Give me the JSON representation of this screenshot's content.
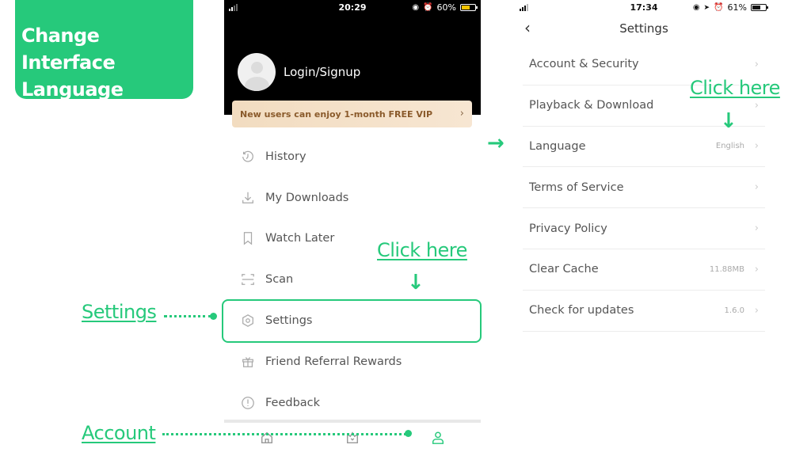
{
  "title_card": {
    "line1": "Change Interface",
    "line2": "Language"
  },
  "annotations": {
    "settings_label": "Settings",
    "account_label": "Account",
    "click_here_1": "Click here",
    "click_here_2": "Click here",
    "arrow_down": "↓",
    "arrow_right": "→"
  },
  "colors": {
    "accent": "#26c97b",
    "vip_bg": "#f2dcc0",
    "vip_text": "#8a5a2b"
  },
  "phone1": {
    "status": {
      "time": "20:29",
      "battery": "60%",
      "battery_fill": 0.6,
      "battery_color": "#f5c400"
    },
    "login_label": "Login/Signup",
    "vip_banner": "New users can enjoy 1-month FREE VIP",
    "chevron": "›",
    "menu": [
      {
        "label": "History",
        "icon": "history-icon"
      },
      {
        "label": "My Downloads",
        "icon": "download-icon"
      },
      {
        "label": "Watch Later",
        "icon": "bookmark-icon"
      },
      {
        "label": "Scan",
        "icon": "scan-icon"
      },
      {
        "label": "Settings",
        "icon": "settings-hexagon-icon"
      },
      {
        "label": "Friend Referral Rewards",
        "icon": "gift-icon"
      },
      {
        "label": "Feedback",
        "icon": "feedback-icon"
      }
    ],
    "tabs": [
      {
        "name": "home",
        "icon": "home-icon",
        "active": false
      },
      {
        "name": "vip",
        "icon": "crown-icon",
        "active": false
      },
      {
        "name": "account",
        "icon": "user-icon",
        "active": true
      }
    ]
  },
  "phone2": {
    "status": {
      "time": "17:34",
      "battery": "61%",
      "battery_fill": 0.61,
      "battery_color": "#111111"
    },
    "title": "Settings",
    "back": "‹",
    "chevron": "›",
    "rows": [
      {
        "label": "Account & Security",
        "value": ""
      },
      {
        "label": "Playback & Download",
        "value": ""
      },
      {
        "label": "Language",
        "value": "English"
      },
      {
        "label": "Terms of Service",
        "value": ""
      },
      {
        "label": "Privacy Policy",
        "value": ""
      },
      {
        "label": "Clear Cache",
        "value": "11.88MB"
      },
      {
        "label": "Check for updates",
        "value": "1.6.0"
      }
    ]
  }
}
